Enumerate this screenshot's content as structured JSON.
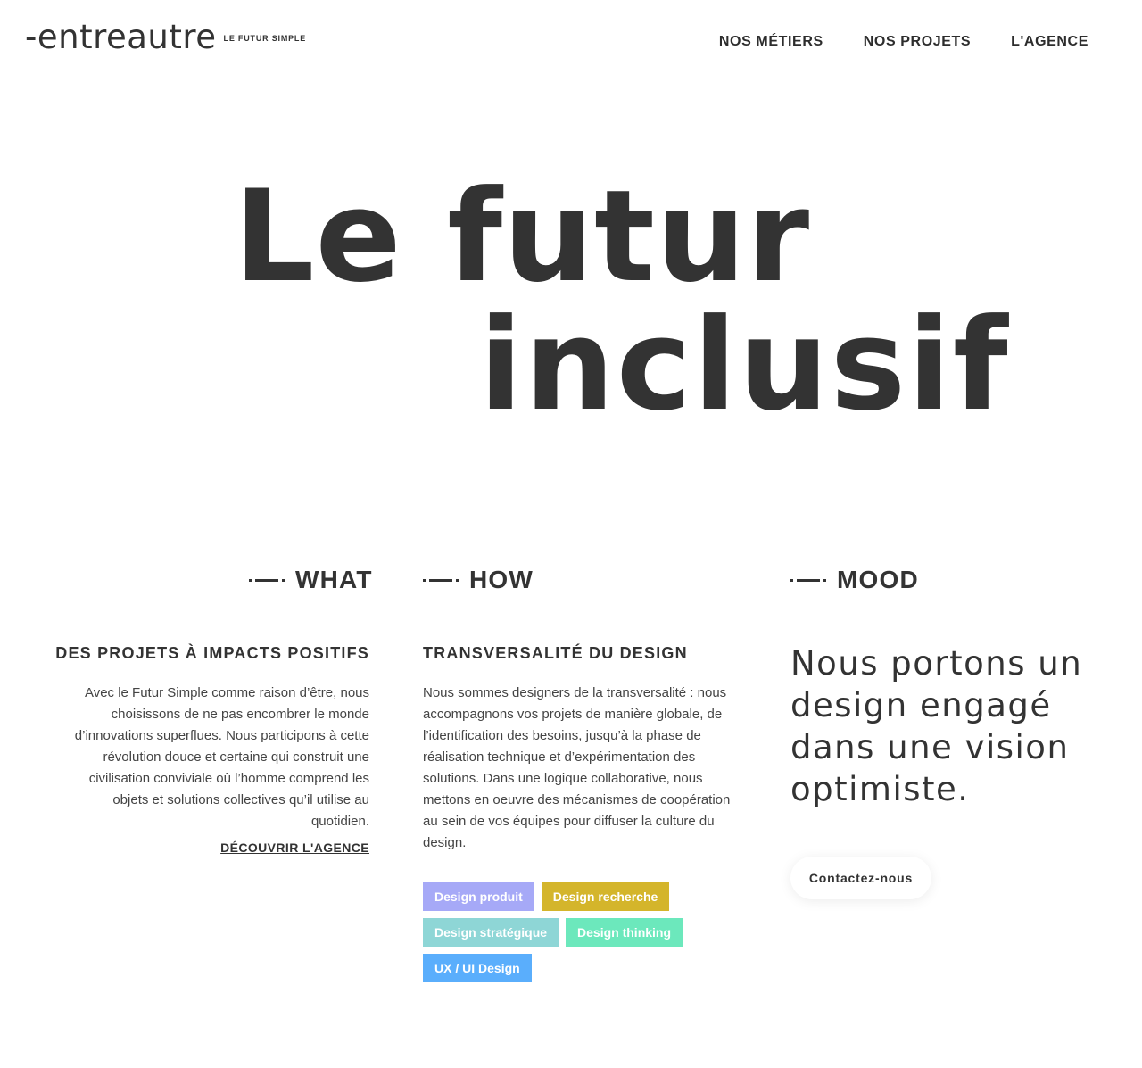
{
  "header": {
    "logo_text": "-entreautre",
    "logo_tagline": "LE FUTUR SIMPLE",
    "nav": [
      {
        "label": "NOS MÉTIERS"
      },
      {
        "label": "NOS PROJETS"
      },
      {
        "label": "L'AGENCE"
      }
    ]
  },
  "hero": {
    "line1": "Le futur",
    "line2": "inclusif"
  },
  "what": {
    "heading": "WHAT",
    "subheading": "DES PROJETS À IMPACTS POSITIFS",
    "body": "Avec le Futur Simple comme raison d’être, nous choisissons de ne pas encombrer le monde d’innovations superflues. Nous participons à cette révolution douce et certaine qui construit une civilisation conviviale où l’homme comprend les objets et solutions collectives qu’il utilise au quotidien.",
    "link": "DÉCOUVRIR L'AGENCE"
  },
  "how": {
    "heading": "HOW",
    "subheading": "TRANSVERSALITÉ DU DESIGN",
    "body": "Nous sommes designers de la transversalité : nous accompagnons vos projets de manière globale, de l’identification des besoins, jusqu’à la phase de réalisation technique et d’expérimentation des solutions. Dans une logique collaborative, nous mettons en oeuvre des mécanismes de coopération au sein de vos équipes pour diffuser la culture du design.",
    "tags": [
      {
        "label": "Design produit",
        "color": "#a6a9f7"
      },
      {
        "label": "Design recherche",
        "color": "#d4b52b"
      },
      {
        "label": "Design stratégique",
        "color": "#8ed6d6"
      },
      {
        "label": "Design thinking",
        "color": "#6ce8bc"
      },
      {
        "label": "UX / UI Design",
        "color": "#5aaefc"
      }
    ]
  },
  "mood": {
    "heading": "MOOD",
    "statement": "Nous portons un design engagé dans une vision optimiste.",
    "cta": "Contactez-nous"
  }
}
